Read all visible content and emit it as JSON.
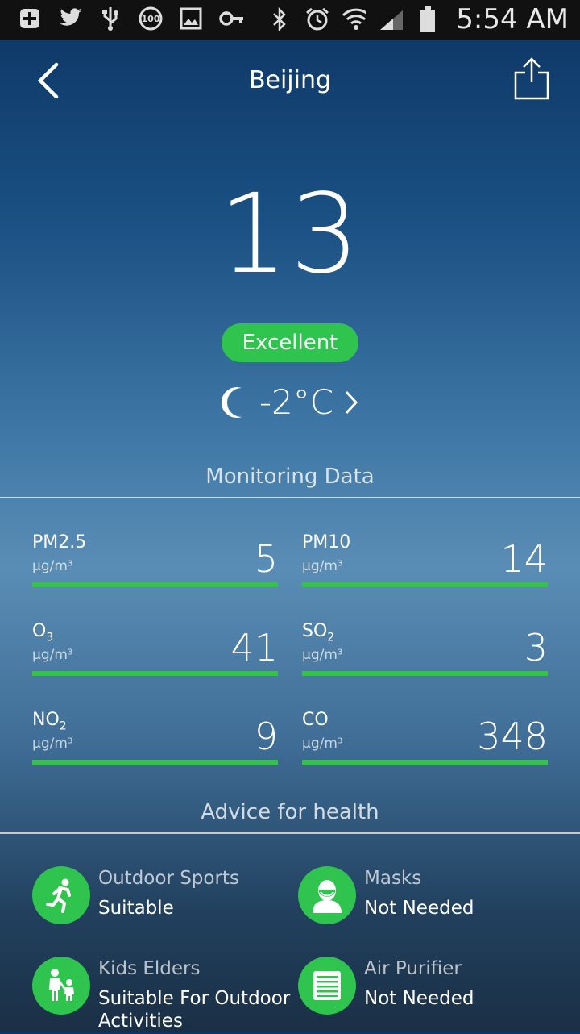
{
  "status_bar": {
    "time": "5:54 AM",
    "left_icons": [
      "plus-box-icon",
      "twitter-icon",
      "usb-icon",
      "badge-100-icon",
      "image-icon",
      "key-icon"
    ],
    "right_icons": [
      "bluetooth-icon",
      "alarm-icon",
      "wifi-icon",
      "signal-icon",
      "battery-icon"
    ]
  },
  "header": {
    "title": "Beijing"
  },
  "aqi": {
    "value": "13",
    "level": "Excellent",
    "level_color": "#2ec44e"
  },
  "weather": {
    "icon": "moon-icon",
    "temperature": "-2°C"
  },
  "monitoring": {
    "title": "Monitoring Data",
    "items": [
      {
        "name": "PM2.5",
        "unit": "μg/m³",
        "value": "5"
      },
      {
        "name": "PM10",
        "unit": "μg/m³",
        "value": "14"
      },
      {
        "name": "O",
        "sub": "3",
        "unit": "μg/m³",
        "value": "41"
      },
      {
        "name": "SO",
        "sub": "2",
        "unit": "μg/m³",
        "value": "3"
      },
      {
        "name": "NO",
        "sub": "2",
        "unit": "μg/m³",
        "value": "9"
      },
      {
        "name": "CO",
        "unit": "μg/m³",
        "value": "348"
      }
    ]
  },
  "health": {
    "title": "Advice for health",
    "items": [
      {
        "icon": "runner-icon",
        "label": "Outdoor Sports",
        "value": "Suitable"
      },
      {
        "icon": "mask-icon",
        "label": "Masks",
        "value": "Not Needed"
      },
      {
        "icon": "family-icon",
        "label": "Kids Elders",
        "value": "Suitable For Outdoor Activities"
      },
      {
        "icon": "air-purifier-icon",
        "label": "Air Purifier",
        "value": "Not Needed"
      }
    ]
  }
}
